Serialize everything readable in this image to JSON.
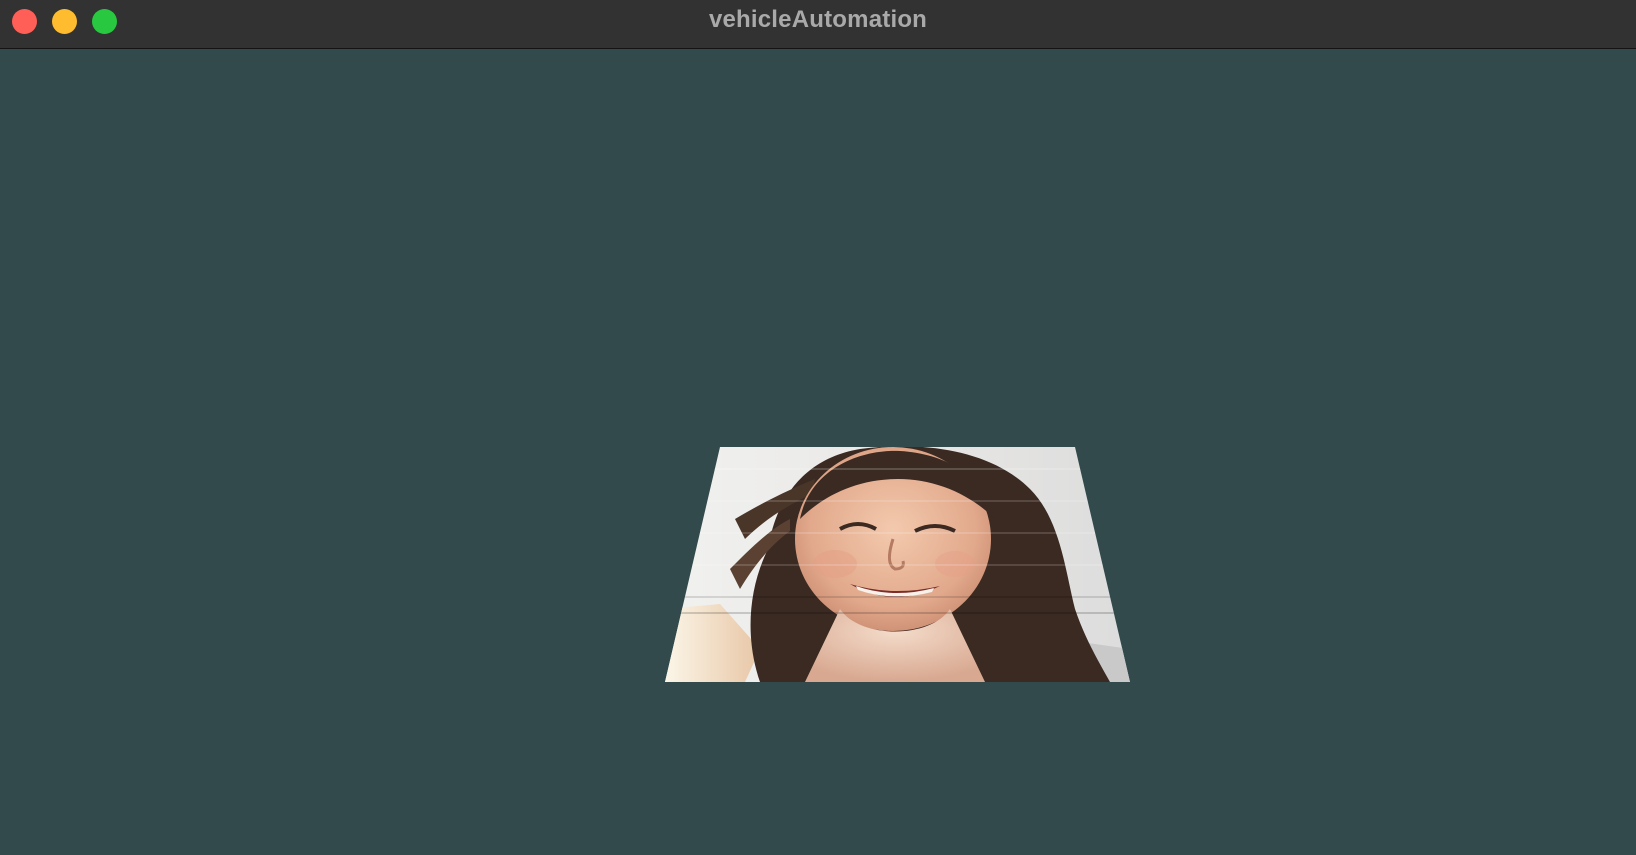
{
  "window": {
    "title": "vehicleAutomation",
    "background_color": "#324a4c",
    "titlebar_color": "#323232"
  },
  "traffic_lights": {
    "close_color": "#ff5f57",
    "minimize_color": "#febc2e",
    "zoom_color": "#28c840"
  },
  "scene": {
    "object": "perspective-textured-quad",
    "texture_subject": "photo of a smiling woman with long dark hair",
    "icon": "photo-texture"
  }
}
